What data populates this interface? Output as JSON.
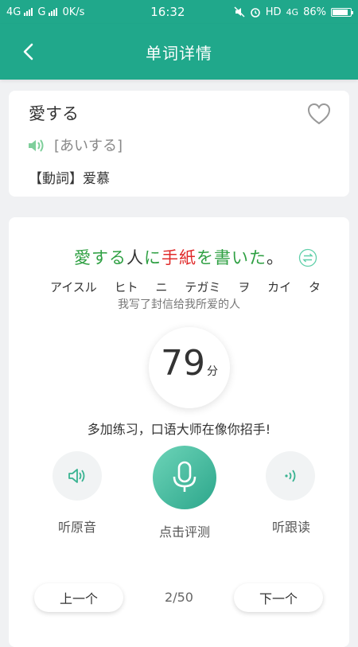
{
  "status_bar": {
    "net1": "4G",
    "net2": "G",
    "speed": "0K/s",
    "time": "16:32",
    "hd": "HD",
    "net3": "4G",
    "battery": "86%",
    "battery_level": 0.86
  },
  "header": {
    "title": "单词详情",
    "back_icon": "chevron-left-icon"
  },
  "word_card": {
    "word": "愛する",
    "reading": "[あいする]",
    "definition": "【動詞】爱慕",
    "icons": [
      "heart-outline-icon",
      "speaker-icon"
    ]
  },
  "practice": {
    "sentence_segments": [
      {
        "text": "愛する",
        "color": "#2fa043"
      },
      {
        "text": "人",
        "color": "#333333"
      },
      {
        "text": "に",
        "color": "#2fa043"
      },
      {
        "text": "手紙",
        "color": "#e02a2a"
      },
      {
        "text": "を",
        "color": "#2fa043"
      },
      {
        "text": "書いた",
        "color": "#2fa043"
      },
      {
        "text": "。",
        "color": "#333333"
      }
    ],
    "kana": [
      "アイスル",
      "ヒト",
      "ニ",
      "テガミ",
      "ヲ",
      "カイ",
      "タ"
    ],
    "translation": "我写了封信给我所爱的人",
    "score": "79",
    "score_unit": "分",
    "feedback": "多加练习，口语大师在像你招手!",
    "listen_original": "听原音",
    "record": "点击评测",
    "listen_followup": "听跟读",
    "prev": "上一个",
    "next": "下一个",
    "page": "2/50",
    "accent_color": "#20a88b"
  }
}
